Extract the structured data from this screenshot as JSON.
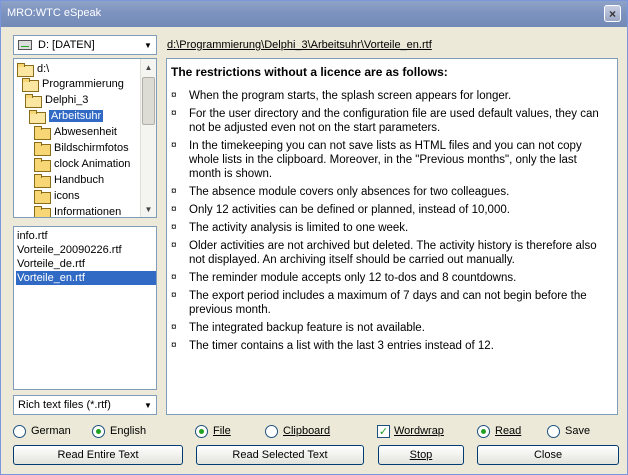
{
  "window": {
    "title": "MRO:WTC eSpeak",
    "close_glyph": "×"
  },
  "drive": {
    "value": "D: [DATEN]"
  },
  "path": "d:\\Programmierung\\Delphi_3\\Arbeitsuhr\\Vorteile_en.rtf",
  "tree": [
    {
      "label": "d:\\",
      "open": true
    },
    {
      "label": "Programmierung",
      "open": true
    },
    {
      "label": "Delphi_3",
      "open": true
    },
    {
      "label": "Arbeitsuhr",
      "open": true,
      "selected": true
    },
    {
      "label": "Abwesenheit"
    },
    {
      "label": "Bildschirmfotos"
    },
    {
      "label": "clock Animation"
    },
    {
      "label": "Handbuch"
    },
    {
      "label": "icons"
    },
    {
      "label": "Informationen"
    }
  ],
  "files": [
    "info.rtf",
    "Vorteile_20090226.rtf",
    "Vorteile_de.rtf",
    "Vorteile_en.rtf"
  ],
  "filter": {
    "value": "Rich text files (*.rtf)"
  },
  "document": {
    "heading": "The restrictions without a licence are as follows:",
    "bullet_mark": "¤",
    "bullets": [
      "When the program starts, the splash screen appears for longer.",
      "For the user directory and the configuration file are used default values, they can not be adjusted even not on the start parameters.",
      "In the timekeeping you can not save lists as HTML files and you can not copy whole lists in the clipboard. Moreover, in the \"Previous months\", only the last month is shown.",
      "The absence module covers only absences for two colleagues.",
      "Only 12 activities can be defined or planned, instead of 10,000.",
      "The activity analysis is limited to one week.",
      "Older activities are not archived but deleted. The activity history is therefore also not displayed. An archiving itself should be carried out manually.",
      "The reminder module accepts only 12 to-dos and 8 countdowns.",
      "The export period includes a maximum of 7 days and can not begin before the previous month.",
      "The integrated backup feature is not available.",
      "The timer contains a list with the last 3 entries instead of 12."
    ]
  },
  "options": {
    "german": "German",
    "english": "English",
    "file": "File",
    "clipboard": "Clipboard",
    "wordwrap": "Wordwrap",
    "read": "Read",
    "save": "Save"
  },
  "buttons": {
    "read_entire": "Read Entire Text",
    "read_selected": "Read Selected Text",
    "stop": "Stop",
    "close": "Close"
  }
}
